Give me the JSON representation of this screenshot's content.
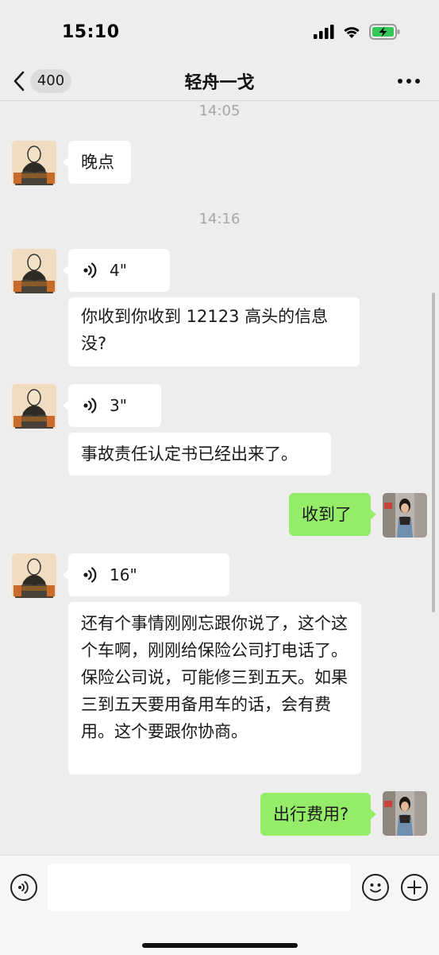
{
  "status": {
    "time": "15:10"
  },
  "nav": {
    "back_count": "400",
    "title": "轻舟一戈"
  },
  "chat": {
    "timestamps": [
      "14:05",
      "14:16"
    ],
    "messages": {
      "m1": "晚点",
      "v1": "4\"",
      "m2": "你收到你收到 12123 高头的信息没?",
      "v2": "3\"",
      "m3": "事故责任认定书已经出来了。",
      "m4": "收到了",
      "v3": "16\"",
      "m5": "还有个事情刚刚忘跟你说了，这个这个车啊，刚刚给保险公司打电话了。保险公司说，可能修三到五天。如果三到五天要用备用车的话，会有费用。这个要跟你协商。",
      "m6": "出行费用?"
    }
  },
  "input": {
    "value": ""
  },
  "colors": {
    "background": "#ededed",
    "incoming_bubble": "#ffffff",
    "outgoing_bubble": "#95ec69"
  }
}
